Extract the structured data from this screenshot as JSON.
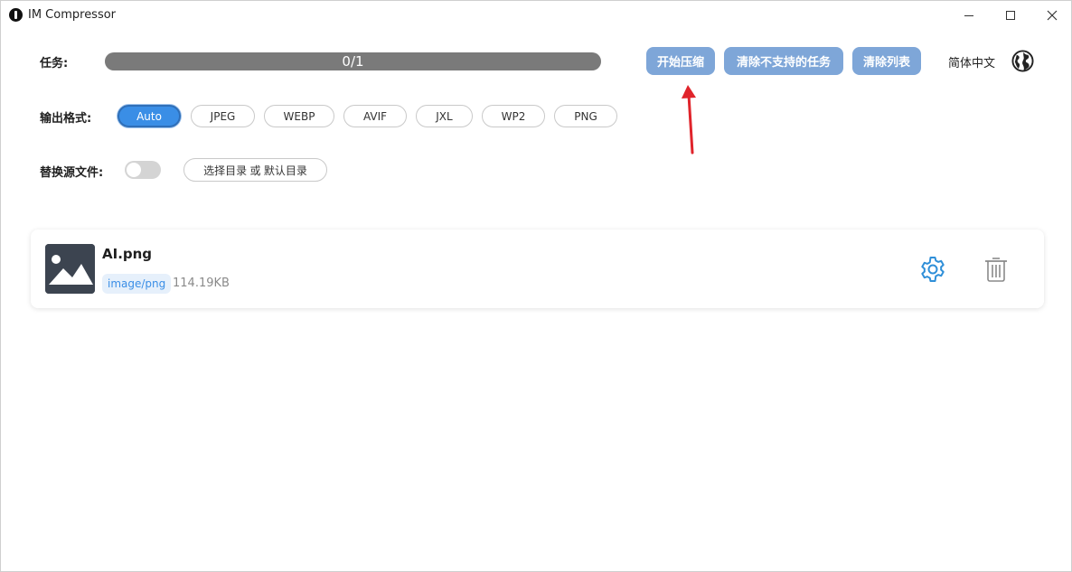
{
  "window": {
    "title": "IM Compressor"
  },
  "task": {
    "label": "任务:",
    "progress_text": "0/1",
    "progress_fraction": 1.0
  },
  "actions": {
    "start_label": "开始压缩",
    "clear_unsupported_label": "清除不支持的任务",
    "clear_list_label": "清除列表"
  },
  "language": {
    "label": "简体中文",
    "icon": "globe-icon"
  },
  "output_format": {
    "label": "输出格式:",
    "options": [
      "Auto",
      "JPEG",
      "WEBP",
      "AVIF",
      "JXL",
      "WP2",
      "PNG"
    ],
    "selected": "Auto"
  },
  "replace_source": {
    "label": "替换源文件:",
    "enabled": false,
    "dir_button_label": "选择目录 或 默认目录"
  },
  "files": [
    {
      "name": "AI.png",
      "mime": "image/png",
      "size": "114.19KB",
      "icons": [
        "image-thumbnail-icon",
        "gear-icon",
        "trash-icon"
      ]
    }
  ],
  "colors": {
    "accent": "#3a8ee6",
    "action_button": "#7ea6d8",
    "progress_fill": "#7a7a7a",
    "annotation_arrow": "#e0242b"
  }
}
